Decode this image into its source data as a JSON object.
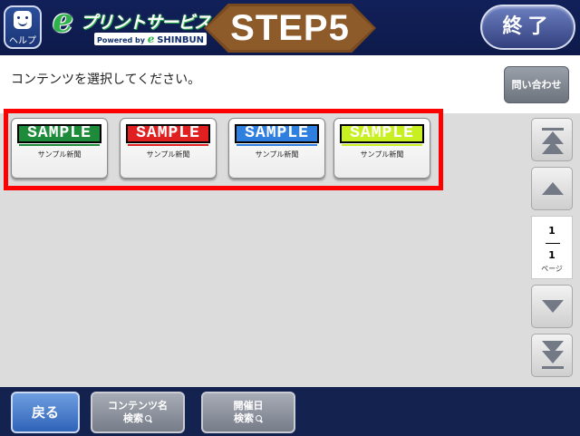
{
  "header": {
    "help_label": "ヘルプ",
    "logo_main": "プリントサービス",
    "logo_powered": "Powered by",
    "logo_brand": "SHINBUN",
    "step": "STEP5",
    "end_label": "終了"
  },
  "instruction": {
    "text": "コンテンツを選択してください。",
    "contact_label": "問い合わせ"
  },
  "contents": [
    {
      "banner": "SAMPLE",
      "label": "サンプル新聞",
      "color": "#1e8b3a"
    },
    {
      "banner": "SAMPLE",
      "label": "サンプル新聞",
      "color": "#e02020"
    },
    {
      "banner": "SAMPLE",
      "label": "サンプル新聞",
      "color": "#2f7fe0"
    },
    {
      "banner": "SAMPLE",
      "label": "サンプル新聞",
      "color": "#c8f020"
    }
  ],
  "pager": {
    "current": "1",
    "total": "1",
    "unit": "ページ"
  },
  "footer": {
    "back_label": "戻る",
    "content_search_line1": "コンテンツ名",
    "content_search_line2": "検索",
    "date_search_line1": "開催日",
    "date_search_line2": "検索"
  },
  "colors": {
    "header_bg": "#12205a",
    "step_brown": "#8d5a2a",
    "selection_red": "#ff0000",
    "back_blue": "#2f63b8"
  }
}
